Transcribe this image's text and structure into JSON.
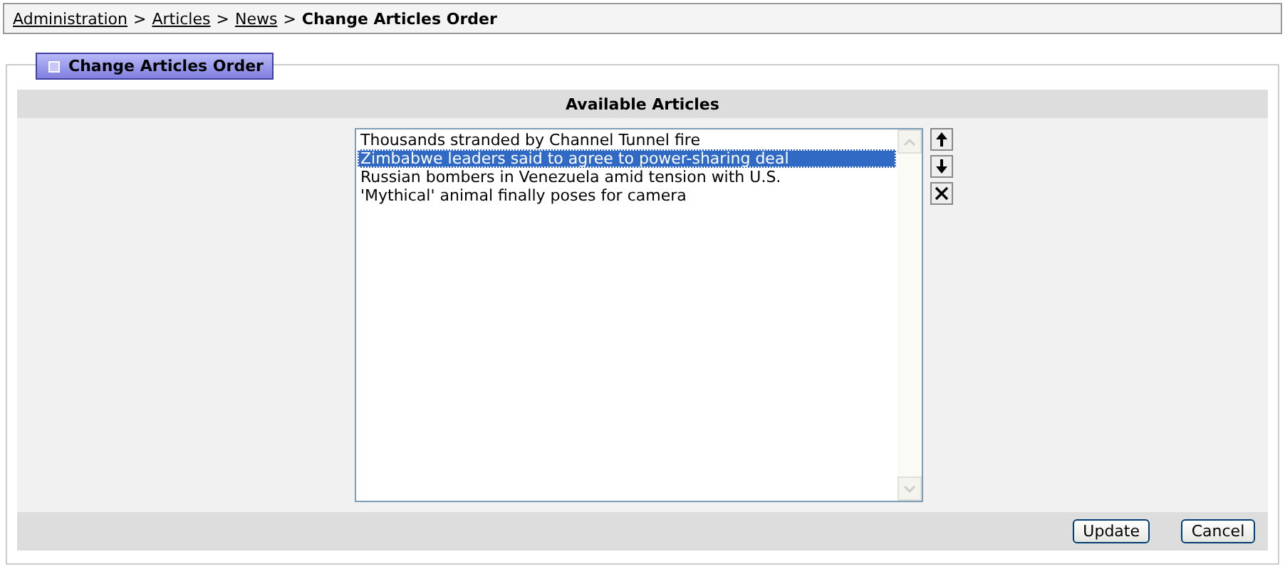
{
  "breadcrumb": [
    {
      "label": "Administration",
      "link": true
    },
    {
      "label": "Articles",
      "link": true
    },
    {
      "label": "News",
      "link": true
    },
    {
      "label": "Change Articles Order",
      "link": false
    }
  ],
  "breadcrumb_separator": ">",
  "panel": {
    "title": "Change Articles Order"
  },
  "list": {
    "heading": "Available Articles",
    "items": [
      {
        "label": "Thousands stranded by Channel Tunnel fire",
        "selected": false
      },
      {
        "label": "Zimbabwe leaders said to agree to power-sharing deal",
        "selected": true
      },
      {
        "label": "Russian bombers in Venezuela amid tension with U.S.",
        "selected": false
      },
      {
        "label": "'Mythical' animal finally poses for camera",
        "selected": false
      }
    ]
  },
  "side_buttons": [
    {
      "kind": "up"
    },
    {
      "kind": "down"
    },
    {
      "kind": "remove"
    }
  ],
  "buttons": [
    "Update",
    "Cancel"
  ]
}
